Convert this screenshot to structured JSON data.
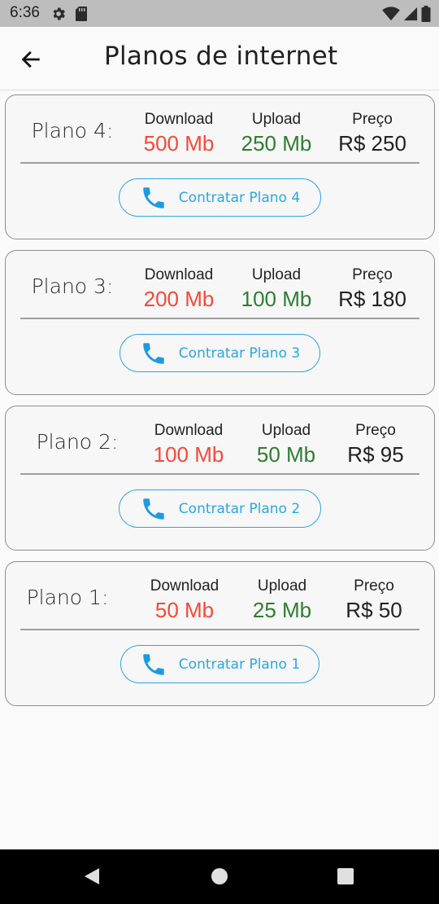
{
  "status_bar": {
    "time": "6:36",
    "icons": [
      "settings-icon",
      "sd-card-icon",
      "wifi-icon",
      "signal-icon",
      "battery-icon"
    ]
  },
  "app_bar": {
    "title": "Planos de internet",
    "back_icon": "arrow-left-icon"
  },
  "labels": {
    "download": "Download",
    "upload": "Upload",
    "price": "Preço"
  },
  "plans": [
    {
      "name": "Plano 4:",
      "download": "500 Mb",
      "upload": "250 Mb",
      "price": "R$ 250",
      "button": "Contratar Plano 4"
    },
    {
      "name": "Plano 3:",
      "download": "200 Mb",
      "upload": "100 Mb",
      "price": "R$ 180",
      "button": "Contratar Plano 3"
    },
    {
      "name": "Plano 2:",
      "download": "100 Mb",
      "upload": "50 Mb",
      "price": "R$ 95",
      "button": "Contratar Plano 2"
    },
    {
      "name": "Plano 1:",
      "download": "50 Mb",
      "upload": "25 Mb",
      "price": "R$ 50",
      "button": "Contratar Plano 1"
    }
  ],
  "colors": {
    "download": "#f14a3a",
    "upload": "#2e7d32",
    "accent": "#2ba6e3"
  },
  "nav_bar": {
    "icons": [
      "back-triangle-icon",
      "home-circle-icon",
      "recents-square-icon"
    ]
  }
}
